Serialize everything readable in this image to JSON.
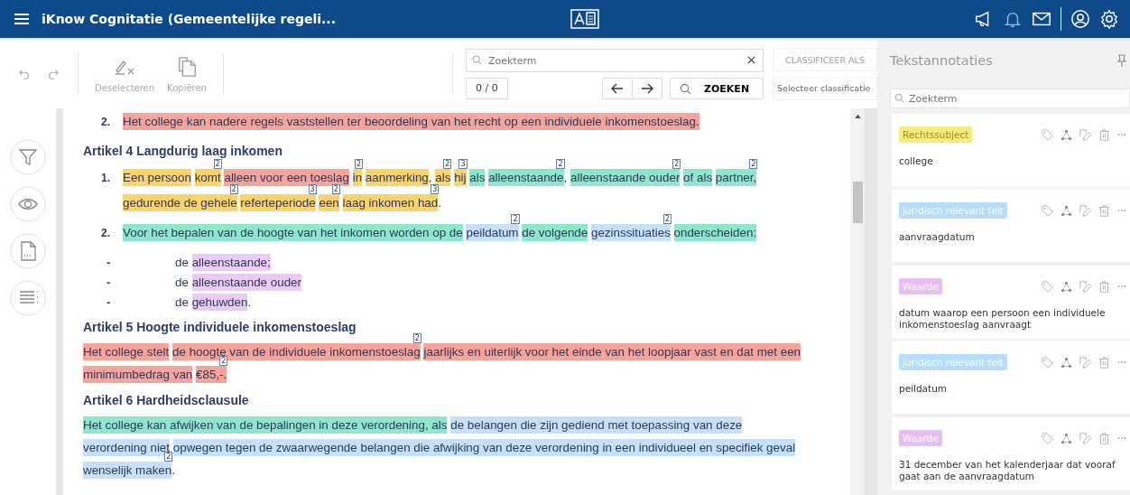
{
  "app_bar": {
    "title": "iKnow Cognitatie (Gemeentelijke regeli..."
  },
  "toolbar": {
    "deselect": {
      "label": "Deselecteren",
      "disabled": true
    },
    "copy": {
      "label": "Kopiëren",
      "disabled": true
    }
  },
  "search": {
    "placeholder": "Zoekterm",
    "count": "0 / 0",
    "button": "ZOEKEN"
  },
  "classify": {
    "button": "CLASSIFICEER ALS",
    "placeholder": "Selecteer classificatie"
  },
  "document": {
    "blocks": [
      {
        "kind": "numbered",
        "number": "2.",
        "segments": [
          {
            "text": "Het college kan nadere regels vaststellen ter beoordeling van het recht op een individuele inkomenstoeslag.",
            "color": "#f6a39c"
          }
        ]
      },
      {
        "kind": "heading",
        "text": "Artikel 4 Langdurig laag inkomen"
      },
      {
        "kind": "numbered",
        "number": "1.",
        "segments": [
          {
            "text": "Een persoon",
            "color": "#fbd36b"
          },
          {
            "text": "komt",
            "color": "#fbd36b",
            "ref": "2"
          },
          {
            "text": "alleen voor een toeslag",
            "color": "#f6a39c"
          },
          {
            "text": "in",
            "color": "#fbd36b",
            "ref": "2"
          },
          {
            "text": "aanmerking",
            "color": "#fbd36b"
          },
          {
            "text": ",",
            "joined": true
          },
          {
            "text": "als",
            "color": "#fbd36b",
            "ref": "2"
          },
          {
            "text": "hij",
            "color": "#fbd36b",
            "ref": "3"
          },
          {
            "text": "als",
            "color": "#8ee6cc"
          },
          {
            "text": "alleenstaande",
            "color": "#8ee6cc",
            "ref": "2"
          },
          {
            "text": ",",
            "joined": true
          },
          {
            "text": "alleenstaande ouder",
            "color": "#8ee6cc",
            "ref": "2"
          },
          {
            "text": "of als",
            "color": "#8ee6cc"
          },
          {
            "text": "partner,",
            "color": "#8ee6cc",
            "ref": "2",
            "break_after": true
          },
          {
            "text": "gedurende de gehele",
            "color": "#fbd36b",
            "ref": "2"
          },
          {
            "text": "referteperiode",
            "color": "#fbd36b",
            "ref": "3"
          },
          {
            "text": "een",
            "color": "#fbd36b",
            "ref": "2"
          },
          {
            "text": "laag inkomen had",
            "color": "#fbd36b",
            "ref": "3"
          },
          {
            "text": ".",
            "joined": true
          }
        ]
      },
      {
        "kind": "numbered",
        "number": "2.",
        "segments": [
          {
            "text": "Voor het bepalen van de hoogte van het inkomen worden op de",
            "color": "#8ee6cc"
          },
          {
            "text": "peildatum",
            "color": "#c6e0fb",
            "ref": "2"
          },
          {
            "text": "de volgende",
            "color": "#8ee6cc"
          },
          {
            "text": "gezinssituaties",
            "color": "#c6e0fb",
            "ref": "2"
          },
          {
            "text": "onderscheiden:",
            "color": "#8ee6cc"
          }
        ]
      },
      {
        "kind": "bullet",
        "marker": "-",
        "segments": [
          {
            "text": "de"
          },
          {
            "text": "alleenstaande;",
            "color": "#efc9f6"
          }
        ]
      },
      {
        "kind": "bullet",
        "marker": "-",
        "segments": [
          {
            "text": "de"
          },
          {
            "text": "alleenstaande ouder",
            "color": "#efc9f6"
          }
        ]
      },
      {
        "kind": "bullet",
        "marker": "-",
        "segments": [
          {
            "text": "de"
          },
          {
            "text": "gehuwden",
            "color": "#efc9f6"
          },
          {
            "text": ".",
            "joined": true
          }
        ]
      },
      {
        "kind": "heading",
        "text": "Artikel 5 Hoogte individuele inkomenstoeslag"
      },
      {
        "kind": "paragraph",
        "segments": [
          {
            "text": "Het college stelt",
            "color": "#f6a39c"
          },
          {
            "text": "de hoogte van de individuele inkomenstoeslag",
            "color": "#f6a39c",
            "ref": "2"
          },
          {
            "text": "jaarlijks en uiterlijk voor het einde van het loopjaar vast en dat met een",
            "color": "#f6a39c",
            "break_after": true
          },
          {
            "text": "minimumbedrag van",
            "color": "#f6a39c"
          },
          {
            "text": "€85,-.",
            "color": "#f6a39c",
            "ref": "2"
          }
        ]
      },
      {
        "kind": "heading",
        "text": "Artikel 6 Hardheidsclausule"
      },
      {
        "kind": "paragraph",
        "segments": [
          {
            "text": "Het college kan afwijken van de bepalingen in deze verordening, als",
            "color": "#8ee6cc"
          },
          {
            "text": "de belangen die zijn gediend met toepassing van deze",
            "color": "#c6e0fb",
            "break_after": true
          },
          {
            "text": "verordening niet",
            "color": "#c6e0fb"
          },
          {
            "text": "opwegen tegen de zwaarwegende belangen die afwijking van deze verordening in een individueel en specifiek geval",
            "color": "#c6e0fb",
            "break_after": true
          },
          {
            "text": "wenselijk maken",
            "color": "#c6e0fb",
            "ref": "2"
          },
          {
            "text": ".",
            "joined": true
          }
        ]
      }
    ]
  },
  "annotations_panel": {
    "title": "Tekstannotaties",
    "search_placeholder": "Zoekterm",
    "cards": [
      {
        "label": "Rechtssubject",
        "color": "#f7ea7c",
        "text": "college"
      },
      {
        "label": "Juridisch relevant feit",
        "color": "#b5dcfa",
        "text": "aanvraagdatum"
      },
      {
        "label": "Waarde",
        "color": "#e8bdf3",
        "text": "datum waarop een persoon een individuele inkomenstoeslag aanvraagt"
      },
      {
        "label": "Juridisch relevant feit",
        "color": "#b5dcfa",
        "text": "peildatum"
      },
      {
        "label": "Waarde",
        "color": "#e8bdf3",
        "text": "31 december van het kalenderjaar dat vooraf gaat aan de aanvraagdatum"
      }
    ]
  }
}
